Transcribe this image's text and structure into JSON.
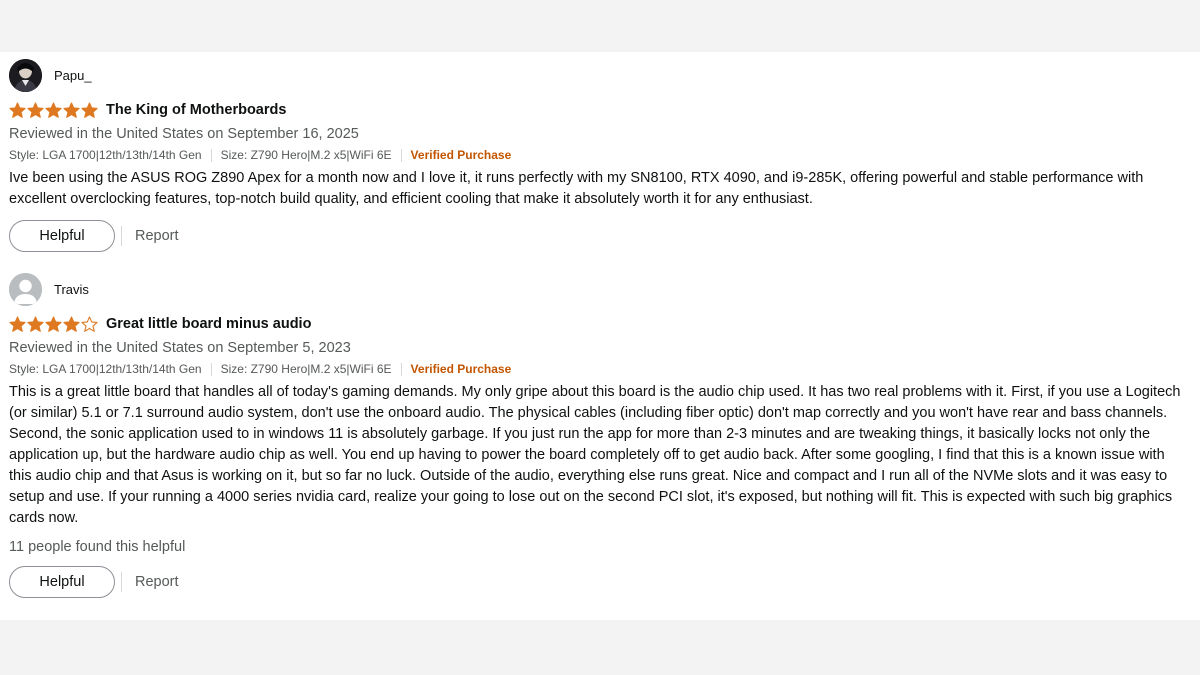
{
  "reviews": [
    {
      "profile_name": "Papu_",
      "avatar": "dark-portrait-avatar",
      "rating": 5,
      "max_rating": 5,
      "title": "The King of Motherboards",
      "date_text": "Reviewed in the United States on September 16, 2025",
      "style": "Style: LGA 1700|12th/13th/14th Gen",
      "size": "Size: Z790 Hero|M.2 x5|WiFi 6E",
      "verified": "Verified Purchase",
      "body": "Ive been using the ASUS ROG Z890 Apex for a month now and I love it, it runs perfectly with my SN8100, RTX 4090, and i9-285K, offering powerful and stable performance with excellent overclocking features, top-notch build quality, and efficient cooling that make it absolutely worth it for any enthusiast.",
      "helpful_count": "",
      "helpful_label": "Helpful",
      "report_label": "Report"
    },
    {
      "profile_name": "Travis",
      "avatar": "default-user-avatar",
      "rating": 4,
      "max_rating": 5,
      "title": "Great little board minus audio",
      "date_text": "Reviewed in the United States on September 5, 2023",
      "style": "Style: LGA 1700|12th/13th/14th Gen",
      "size": "Size: Z790 Hero|M.2 x5|WiFi 6E",
      "verified": "Verified Purchase",
      "body": "This is a great little board that handles all of today's gaming demands. My only gripe about this board is the audio chip used. It has two real problems with it. First, if you use a Logitech (or similar) 5.1 or 7.1 surround audio system, don't use the onboard audio. The physical cables (including fiber optic) don't map correctly and you won't have rear and bass channels. Second, the sonic application used to in windows 11 is absolutely garbage. If you just run the app for more than 2-3 minutes and are tweaking things, it basically locks not only the application up, but the hardware audio chip as well. You end up having to power the board completely off to get audio back. After some googling, I find that this is a known issue with this audio chip and that Asus is working on it, but so far no luck. Outside of the audio, everything else runs great. Nice and compact and I run all of the NVMe slots and it was easy to setup and use. If your running a 4000 series nvidia card, realize your going to lose out on the second PCI slot, it's exposed, but nothing will fit. This is expected with such big graphics cards now.",
      "helpful_count": "11 people found this helpful",
      "helpful_label": "Helpful",
      "report_label": "Report"
    }
  ],
  "colors": {
    "star_fill": "#de7921",
    "star_empty_stroke": "#de7921",
    "verified": "#c45500",
    "secondary_text": "#565959"
  },
  "icons": {
    "star_full": "star-filled-icon",
    "star_empty": "star-outline-icon"
  }
}
